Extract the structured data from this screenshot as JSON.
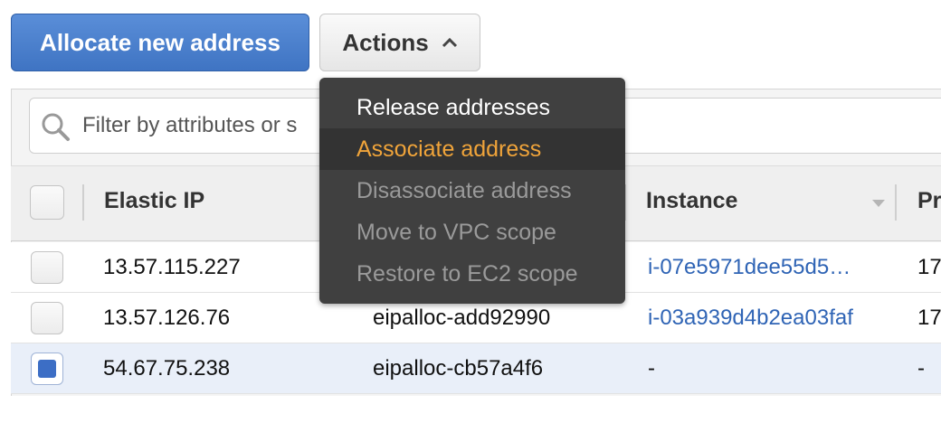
{
  "toolbar": {
    "allocate_label": "Allocate new address",
    "actions_label": "Actions"
  },
  "filter": {
    "placeholder": "Filter by attributes or s"
  },
  "table": {
    "columns": [
      "Elastic IP",
      "Instance",
      "Pr"
    ],
    "rows": [
      {
        "ip": "13.57.115.227",
        "allocation": "",
        "instance": "i-07e5971dee55d5…",
        "extra": "17",
        "selected": false
      },
      {
        "ip": "13.57.126.76",
        "allocation": "eipalloc-add92990",
        "instance": "i-03a939d4b2ea03faf",
        "extra": "17",
        "selected": false
      },
      {
        "ip": "54.67.75.238",
        "allocation": "eipalloc-cb57a4f6",
        "instance": "-",
        "extra": "-",
        "selected": true
      }
    ]
  },
  "actions_menu": {
    "items": [
      {
        "label": "Release addresses",
        "state": "enabled"
      },
      {
        "label": "Associate address",
        "state": "hover"
      },
      {
        "label": "Disassociate address",
        "state": "disabled"
      },
      {
        "label": "Move to VPC scope",
        "state": "disabled"
      },
      {
        "label": "Restore to EC2 scope",
        "state": "disabled"
      }
    ]
  },
  "colors": {
    "primary": "#3f74c3",
    "link": "#2f64b5",
    "menu_bg": "#404040",
    "menu_active": "#f0a43a",
    "selected_row": "#e9eff9"
  },
  "icons": [
    "search-icon",
    "chevron-up-icon",
    "sort-down-icon"
  ]
}
